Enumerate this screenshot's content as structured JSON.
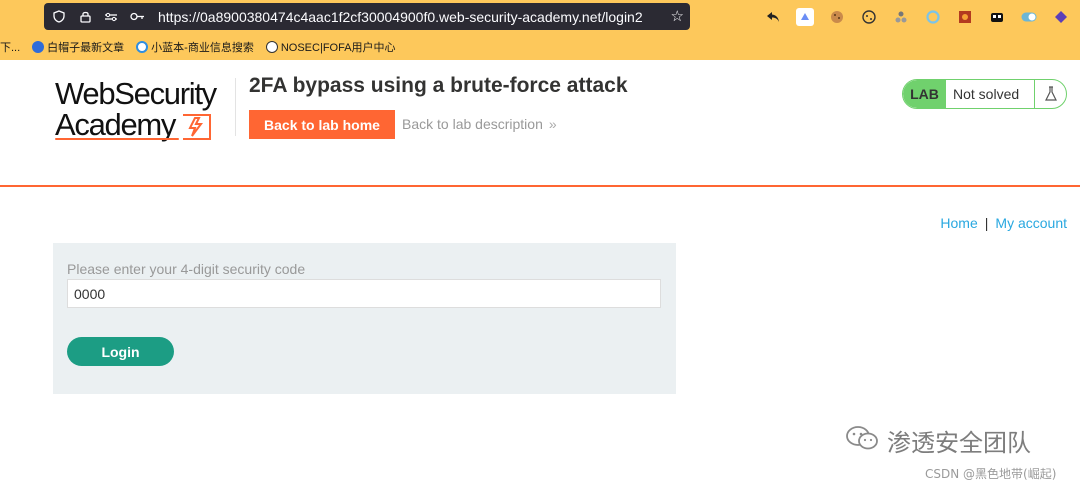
{
  "browser": {
    "url": "https://0a8900380474c4aac1f2cf30004900f0.web-security-academy.net/login2",
    "bookmarks": [
      {
        "label": "下..."
      },
      {
        "label": "白帽子最新文章"
      },
      {
        "label": "小蓝本-商业信息搜索"
      },
      {
        "label": "NOSEC|FOFA用户中心"
      }
    ]
  },
  "header": {
    "logo_line1": "WebSecurity",
    "logo_line2": "Academy",
    "lab_title": "2FA bypass using a brute-force attack",
    "back_home_label": "Back to lab home",
    "back_desc_label": "Back to lab description",
    "status_badge": "LAB",
    "status_text": "Not solved"
  },
  "nav": {
    "home": "Home",
    "separator": "|",
    "account": "My account"
  },
  "form": {
    "label": "Please enter your 4-digit security code",
    "value": "0000",
    "submit_label": "Login"
  },
  "watermark": {
    "team": "渗透安全团队",
    "csdn": "CSDN @黑色地带(崛起)"
  },
  "colors": {
    "accent": "#ff6633",
    "success": "#70d16d",
    "link": "#29a8e0",
    "button": "#1c9d84",
    "chrome": "#fdc85b"
  }
}
